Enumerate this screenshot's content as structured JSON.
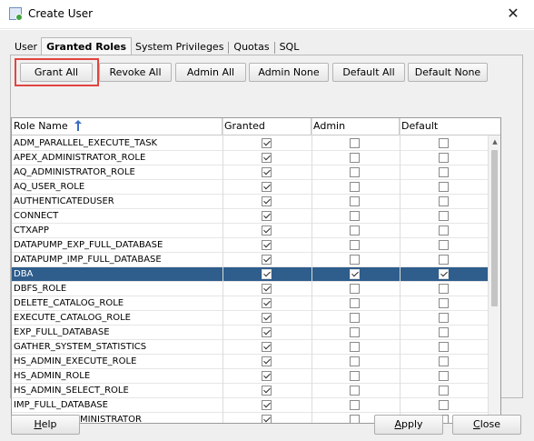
{
  "window": {
    "title": "Create User",
    "close_glyph": "✕"
  },
  "tabs": [
    {
      "label": "User",
      "active": false
    },
    {
      "label": "Granted Roles",
      "active": true
    },
    {
      "label": "System Privileges",
      "active": false
    },
    {
      "label": "Quotas",
      "active": false
    },
    {
      "label": "SQL",
      "active": false
    }
  ],
  "toolbar": {
    "grant_all": "Grant All",
    "revoke_all": "Revoke All",
    "admin_all": "Admin All",
    "admin_none": "Admin None",
    "default_all": "Default All",
    "default_none": "Default None"
  },
  "table": {
    "columns": [
      "Role Name",
      "Granted",
      "Admin",
      "Default"
    ],
    "sort_icon": "sort-ascending-icon",
    "rows": [
      {
        "name": "ADM_PARALLEL_EXECUTE_TASK",
        "granted": true,
        "admin": false,
        "default": false
      },
      {
        "name": "APEX_ADMINISTRATOR_ROLE",
        "granted": true,
        "admin": false,
        "default": false
      },
      {
        "name": "AQ_ADMINISTRATOR_ROLE",
        "granted": true,
        "admin": false,
        "default": false
      },
      {
        "name": "AQ_USER_ROLE",
        "granted": true,
        "admin": false,
        "default": false
      },
      {
        "name": "AUTHENTICATEDUSER",
        "granted": true,
        "admin": false,
        "default": false
      },
      {
        "name": "CONNECT",
        "granted": true,
        "admin": false,
        "default": false
      },
      {
        "name": "CTXAPP",
        "granted": true,
        "admin": false,
        "default": false
      },
      {
        "name": "DATAPUMP_EXP_FULL_DATABASE",
        "granted": true,
        "admin": false,
        "default": false
      },
      {
        "name": "DATAPUMP_IMP_FULL_DATABASE",
        "granted": true,
        "admin": false,
        "default": false
      },
      {
        "name": "DBA",
        "granted": true,
        "admin": true,
        "default": true,
        "selected": true
      },
      {
        "name": "DBFS_ROLE",
        "granted": true,
        "admin": false,
        "default": false
      },
      {
        "name": "DELETE_CATALOG_ROLE",
        "granted": true,
        "admin": false,
        "default": false
      },
      {
        "name": "EXECUTE_CATALOG_ROLE",
        "granted": true,
        "admin": false,
        "default": false
      },
      {
        "name": "EXP_FULL_DATABASE",
        "granted": true,
        "admin": false,
        "default": false
      },
      {
        "name": "GATHER_SYSTEM_STATISTICS",
        "granted": true,
        "admin": false,
        "default": false
      },
      {
        "name": "HS_ADMIN_EXECUTE_ROLE",
        "granted": true,
        "admin": false,
        "default": false
      },
      {
        "name": "HS_ADMIN_ROLE",
        "granted": true,
        "admin": false,
        "default": false
      },
      {
        "name": "HS_ADMIN_SELECT_ROLE",
        "granted": true,
        "admin": false,
        "default": false
      },
      {
        "name": "IMP_FULL_DATABASE",
        "granted": true,
        "admin": false,
        "default": false
      },
      {
        "name": "LOGSTDBY_ADMINISTRATOR",
        "granted": true,
        "admin": false,
        "default": false
      }
    ]
  },
  "footer": {
    "help": {
      "mnemonic": "H",
      "rest": "elp"
    },
    "apply": {
      "mnemonic": "A",
      "rest": "pply"
    },
    "close": {
      "mnemonic": "C",
      "rest": "lose"
    }
  },
  "colors": {
    "selection": "#2f5d8c",
    "highlight_border": "#e0453f"
  }
}
